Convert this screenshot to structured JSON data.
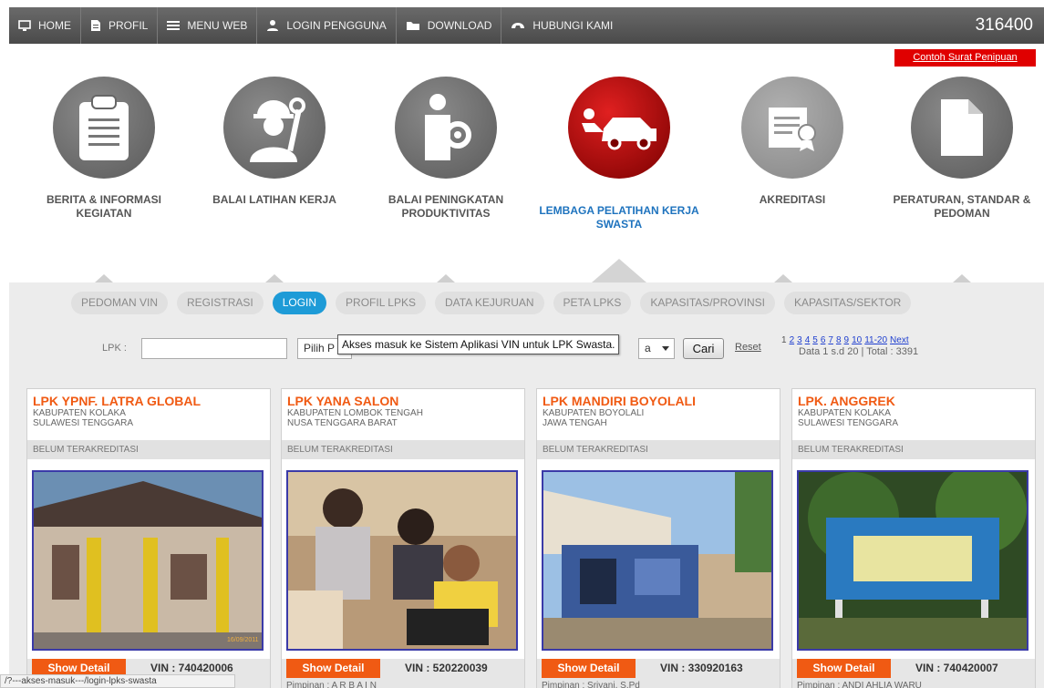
{
  "nav": {
    "items": [
      {
        "label": "HOME",
        "icon": "monitor-icon"
      },
      {
        "label": "PROFIL",
        "icon": "document-icon"
      },
      {
        "label": "MENU WEB",
        "icon": "menu-icon"
      },
      {
        "label": "LOGIN PENGGUNA",
        "icon": "user-icon"
      },
      {
        "label": "DOWNLOAD",
        "icon": "folder-icon"
      },
      {
        "label": "HUBUNGI KAMI",
        "icon": "phone-icon"
      }
    ],
    "counter": "316400"
  },
  "scam_link": "Contoh Surat Penipuan",
  "categories": [
    {
      "label": "BERITA & INFORMASI KEGIATAN",
      "icon": "clipboard-icon"
    },
    {
      "label": "BALAI LATIHAN KERJA",
      "icon": "worker-icon"
    },
    {
      "label": "BALAI PENINGKATAN PRODUKTIVITAS",
      "icon": "productivity-icon"
    },
    {
      "label": "LEMBAGA PELATIHAN KERJA SWASTA",
      "icon": "car-mechanic-icon"
    },
    {
      "label": "AKREDITASI",
      "icon": "certificate-icon"
    },
    {
      "label": "PERATURAN, STANDAR & PEDOMAN",
      "icon": "pages-icon"
    }
  ],
  "subtabs": [
    "PEDOMAN VIN",
    "REGISTRASI",
    "LOGIN",
    "PROFIL LPKS",
    "DATA KEJURUAN",
    "PETA LPKS",
    "KAPASITAS/PROVINSI",
    "KAPASITAS/SEKTOR"
  ],
  "active_subtab": "LOGIN",
  "search": {
    "lpk_label": "LPK :",
    "lpk_value": "",
    "select1": "Pilih P",
    "select2": "a",
    "tooltip": "Akses masuk ke Sistem Aplikasi VIN untuk LPK Swasta.",
    "cari": "Cari",
    "reset": "Reset"
  },
  "pagination": {
    "current": "1",
    "pages": [
      "2",
      "3",
      "4",
      "5",
      "6",
      "7",
      "8",
      "9",
      "10",
      "11-20",
      "Next"
    ],
    "info": "Data 1 s.d 20 | Total : 3391"
  },
  "cards": [
    {
      "name": "LPK YPNF. LATRA GLOBAL",
      "kab": "KABUPATEN KOLAKA",
      "prov": "SULAWESI TENGGARA",
      "status": "BELUM TERAKREDITASI",
      "show": "Show Detail",
      "vin": "VIN : 740420006",
      "pimpinan": "",
      "photo_date": "16/09/2011"
    },
    {
      "name": "LPK YANA SALON",
      "kab": "KABUPATEN LOMBOK TENGAH",
      "prov": "NUSA TENGGARA BARAT",
      "status": "BELUM TERAKREDITASI",
      "show": "Show Detail",
      "vin": "VIN : 520220039",
      "pimpinan": "Pimpinan  :  A R B A I N",
      "photo_date": ""
    },
    {
      "name": "LPK MANDIRI BOYOLALI",
      "kab": "KABUPATEN BOYOLALI",
      "prov": "JAWA TENGAH",
      "status": "BELUM TERAKREDITASI",
      "show": "Show Detail",
      "vin": "VIN : 330920163",
      "pimpinan": "Pimpinan  :  Sriyani, S.Pd",
      "photo_date": ""
    },
    {
      "name": "LPK. ANGGREK",
      "kab": "KABUPATEN KOLAKA",
      "prov": "SULAWESI TENGGARA",
      "status": "BELUM TERAKREDITASI",
      "show": "Show Detail",
      "vin": "VIN : 740420007",
      "pimpinan": "Pimpinan  :  ANDI AHLIA WARU",
      "photo_date": ""
    }
  ],
  "statusbar": "/?---akses-masuk---/login-lpks-swasta"
}
